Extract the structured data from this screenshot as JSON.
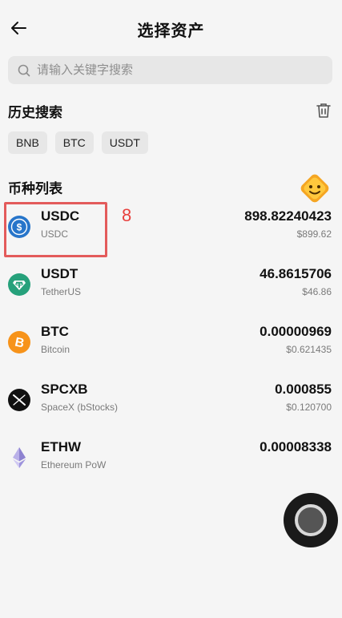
{
  "header": {
    "title": "选择资产"
  },
  "search": {
    "placeholder": "请输入关键字搜索",
    "value": ""
  },
  "history": {
    "title": "历史搜索",
    "chips": [
      "BNB",
      "BTC",
      "USDT"
    ]
  },
  "coin_list": {
    "title": "币种列表",
    "items": [
      {
        "symbol": "USDC",
        "name": "USDC",
        "amount": "898.82240423",
        "value": "$899.62",
        "icon": "usdc-icon"
      },
      {
        "symbol": "USDT",
        "name": "TetherUS",
        "amount": "46.8615706",
        "value": "$46.86",
        "icon": "usdt-icon"
      },
      {
        "symbol": "BTC",
        "name": "Bitcoin",
        "amount": "0.00000969",
        "value": "$0.621435",
        "icon": "btc-icon"
      },
      {
        "symbol": "SPCXB",
        "name": "SpaceX (bStocks)",
        "amount": "0.000855",
        "value": "$0.120700",
        "icon": "spacex-icon"
      },
      {
        "symbol": "ETHW",
        "name": "Ethereum PoW",
        "amount": "0.00008338",
        "value": "",
        "icon": "ethw-icon"
      }
    ]
  },
  "annotation": {
    "number": "8",
    "color": "#e8413e"
  },
  "colors": {
    "usdc": "#2775ca",
    "usdt": "#26a17b",
    "btc": "#f7931a",
    "highlight": "#e35b5b"
  }
}
